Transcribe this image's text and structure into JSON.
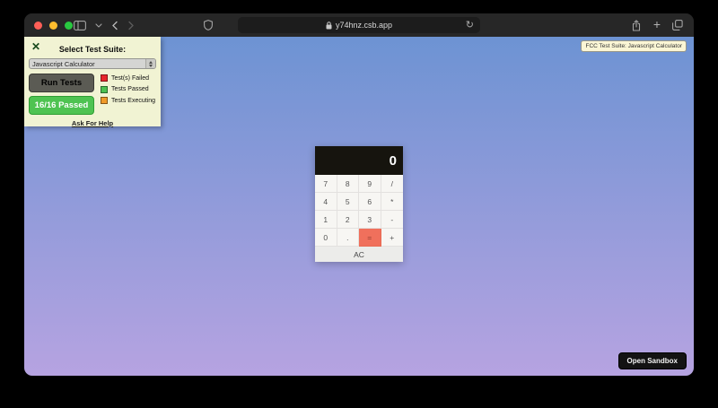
{
  "page": {
    "outer_background": "#000000",
    "gradient_top": "#6d93d3",
    "gradient_bottom": "#b6a3e1"
  },
  "browser": {
    "url": "y74hnz.csb.app",
    "reload_glyph": "↻",
    "new_tab_glyph": "+",
    "traffic_lights": {
      "close": "#ff5f57",
      "minimize": "#febc2e",
      "zoom": "#28c840"
    }
  },
  "test_panel": {
    "close_glyph": "✕",
    "title": "Select Test Suite:",
    "selected_suite": "Javascript Calculator",
    "run_tests_label": "Run Tests",
    "run_tests_color": "#5b5b54",
    "result_label": "16/16 Passed",
    "result_color": "#4ec351",
    "legend": [
      {
        "label": "Test(s) Failed",
        "color": "#e8262b"
      },
      {
        "label": "Tests Passed",
        "color": "#4cc051"
      },
      {
        "label": "Tests Executing",
        "color": "#f09a28"
      }
    ],
    "help_label": "Ask For Help"
  },
  "fcc_badge": {
    "text": "FCC Test Suite: Javascript Calculator"
  },
  "calculator": {
    "display_value": "0",
    "keys": [
      [
        "7",
        "8",
        "9",
        "/"
      ],
      [
        "4",
        "5",
        "6",
        "*"
      ],
      [
        "1",
        "2",
        "3",
        "-"
      ],
      [
        "0",
        ".",
        "=",
        "+"
      ]
    ],
    "equals_color": "#f0705c",
    "clear_label": "AC"
  },
  "footer": {
    "open_sandbox_label": "Open Sandbox"
  }
}
